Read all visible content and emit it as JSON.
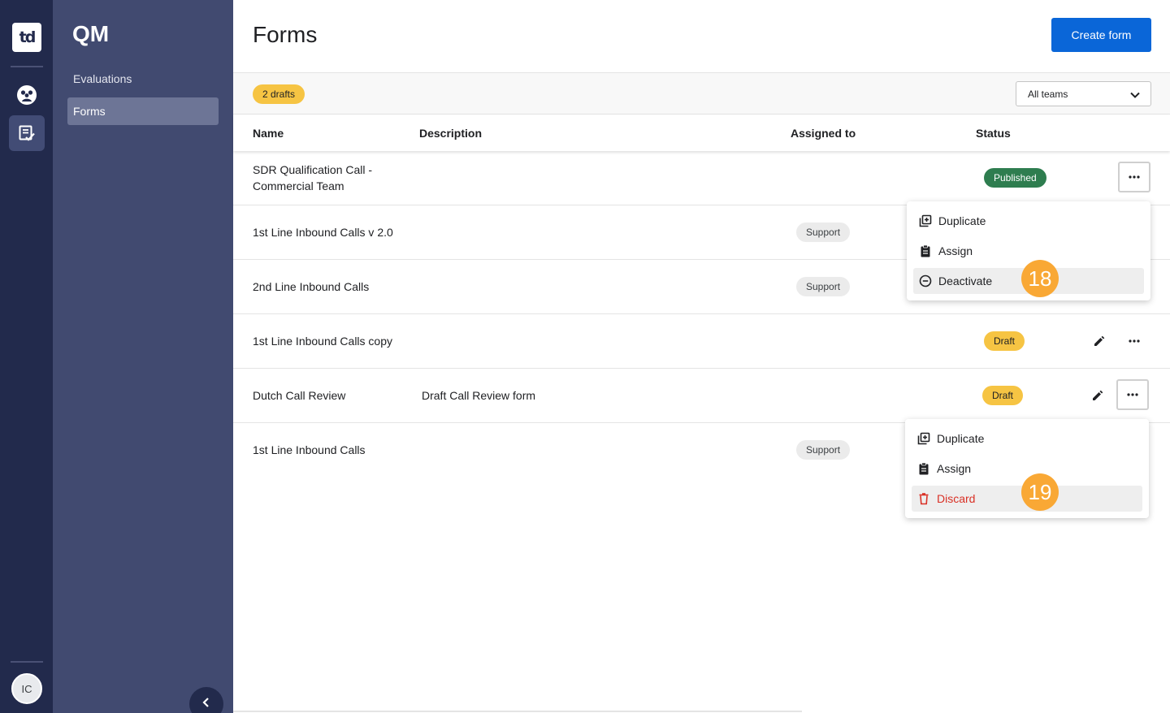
{
  "rail": {
    "logo_text": "td",
    "items": [
      {
        "name": "team-icon",
        "active": false
      },
      {
        "name": "qm-forms-icon",
        "active": true
      }
    ],
    "user_initials": "IC"
  },
  "sidebar": {
    "title": "QM",
    "items": [
      {
        "label": "Evaluations",
        "active": false
      },
      {
        "label": "Forms",
        "active": true
      }
    ]
  },
  "header": {
    "title": "Forms",
    "create_label": "Create form"
  },
  "filters": {
    "drafts_label": "2 drafts",
    "team_select_value": "All teams"
  },
  "table": {
    "columns": [
      "Name",
      "Description",
      "Assigned to",
      "Status"
    ],
    "rows": [
      {
        "name": "SDR Qualification Call - Commercial Team",
        "name_line1": "SDR Qualification Call -",
        "name_line2": "Commercial Team",
        "description": "",
        "assigned_to": "",
        "status": "Published"
      },
      {
        "name": "1st Line Inbound Calls v 2.0",
        "description": "",
        "assigned_to": "Support",
        "status": ""
      },
      {
        "name": "2nd Line Inbound Calls",
        "description": "",
        "assigned_to": "Support",
        "status": ""
      },
      {
        "name": "1st Line Inbound Calls copy",
        "description": "",
        "assigned_to": "",
        "status": "Draft"
      },
      {
        "name": "Dutch Call Review",
        "description": "Draft Call Review form",
        "assigned_to": "",
        "status": "Draft"
      },
      {
        "name": "1st Line Inbound Calls",
        "description": "",
        "assigned_to": "Support",
        "status": ""
      }
    ]
  },
  "menu_published": {
    "items": [
      {
        "label": "Duplicate",
        "icon": "duplicate-icon"
      },
      {
        "label": "Assign",
        "icon": "clipboard-icon"
      },
      {
        "label": "Deactivate",
        "icon": "minus-circle-icon"
      }
    ],
    "step": "18"
  },
  "menu_draft": {
    "items": [
      {
        "label": "Duplicate",
        "icon": "duplicate-icon"
      },
      {
        "label": "Assign",
        "icon": "clipboard-icon"
      },
      {
        "label": "Discard",
        "icon": "trash-icon"
      }
    ],
    "step": "19"
  },
  "colors": {
    "rail_bg": "#222a4c",
    "sidebar_bg": "#414a70",
    "primary": "#0a66d8",
    "draft": "#f6c443",
    "published": "#2e7d4f",
    "danger": "#d93025",
    "step_marker": "#f9a835"
  }
}
